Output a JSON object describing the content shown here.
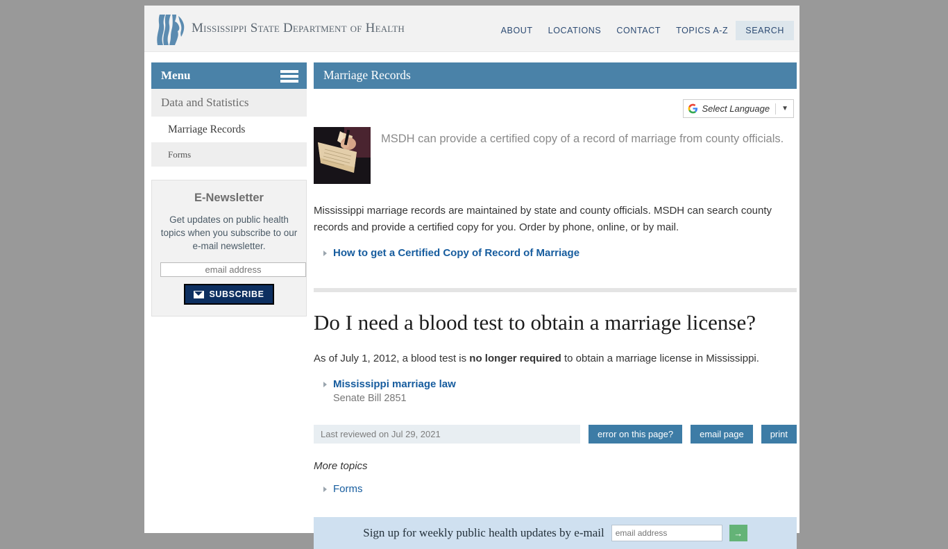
{
  "site": {
    "brand_title": "Mississippi State Department of Health",
    "logo_name": "msdh-profiles-logo"
  },
  "topnav": {
    "items": [
      {
        "label": "ABOUT",
        "name": "nav-about"
      },
      {
        "label": "LOCATIONS",
        "name": "nav-locations"
      },
      {
        "label": "CONTACT",
        "name": "nav-contact"
      },
      {
        "label": "TOPICS A-Z",
        "name": "nav-topics-a-z"
      },
      {
        "label": "SEARCH",
        "name": "nav-search"
      }
    ]
  },
  "sidebar": {
    "menu_label": "Menu",
    "items": [
      {
        "label": "Data and Statistics",
        "level": 1
      },
      {
        "label": "Marriage Records",
        "level": 2,
        "active": true
      },
      {
        "label": "Forms",
        "level": 3
      }
    ],
    "newsletter": {
      "heading": "E-Newsletter",
      "description": "Get updates on public health topics when you subscribe to our e-mail newsletter.",
      "email_placeholder": "email address",
      "email_value": "",
      "subscribe_label": "SUBSCRIBE"
    }
  },
  "content": {
    "page_title": "Marriage Records",
    "translate": {
      "label": "Select Language",
      "caret": "▼"
    },
    "intro": {
      "image_alt": "hand-with-pen-over-old-record-document",
      "text": "MSDH can provide a certified copy of a record of marriage from county officials."
    },
    "paragraph": "Mississippi marriage records are maintained by state and county officials. MSDH can search county records and provide a certified copy for you. Order by phone, online, or by mail.",
    "primary_links": [
      {
        "label": "How to get a Certified Copy of Record of Marriage"
      }
    ],
    "section": {
      "heading": "Do I need a blood test to obtain a marriage license?",
      "body_prefix": "As of July 1, 2012, a blood test is ",
      "body_bold": "no longer required",
      "body_suffix": " to obtain a marriage license in Mississippi.",
      "links": [
        {
          "label": "Mississippi marriage law",
          "note": "Senate Bill 2851"
        }
      ]
    },
    "meta": {
      "reviewed": "Last reviewed on Jul 29, 2021",
      "buttons": [
        {
          "label": "error on this page?"
        },
        {
          "label": "email page"
        },
        {
          "label": "print"
        }
      ]
    },
    "more_topics": {
      "heading": "More topics",
      "links": [
        {
          "label": "Forms"
        }
      ]
    },
    "signup": {
      "text": "Sign up for weekly public health updates by e-mail",
      "placeholder": "email address",
      "value": "",
      "go_label": "→"
    }
  },
  "colors": {
    "header_blue": "#4a82a8",
    "link_blue": "#165c9e",
    "nav_blue": "#2c4a72",
    "subscribe_navy": "#0d2f60",
    "meta_button_blue": "#3d7ca6",
    "signup_bar": "#cfe0f0",
    "signup_go_green": "#64b377",
    "page_bg": "#999999"
  }
}
